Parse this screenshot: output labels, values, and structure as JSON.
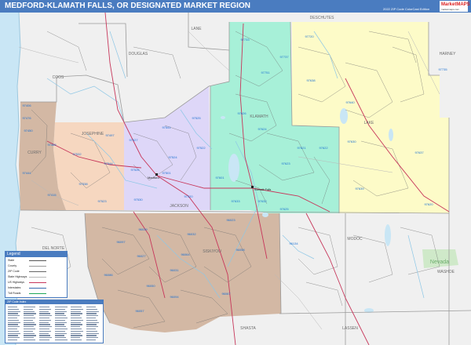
{
  "header": {
    "title": "MEDFORD-KLAMATH FALLS, OR DESIGNATED MARKET REGION",
    "edition": "2022 ZIP Code ColorCast Edition",
    "logo_text": "MarketMAPS",
    "logo_sub": "marketmaps.com"
  },
  "counties": {
    "lane": "LANE",
    "douglas": "DOUGLAS",
    "coos": "COOS",
    "deschutes": "DESCHUTES",
    "harney": "HARNEY",
    "klamath": "KLAMATH",
    "lake": "LAKE",
    "josephine": "JOSEPHINE",
    "jackson": "JACKSON",
    "curry": "CURRY",
    "del_norte": "DEL NORTE",
    "modoc": "MODOC",
    "siskiyou": "SISKIYOU",
    "lassen": "LASSEN",
    "shasta": "SHASTA",
    "washoe": "WASHOE"
  },
  "states": {
    "nevada": "Nevada"
  },
  "cities": {
    "medford": "Medford",
    "klamath_falls": "Klamath Falls"
  },
  "zips": [
    {
      "label": "97733"
    },
    {
      "label": "97737"
    },
    {
      "label": "97751"
    },
    {
      "label": "97720"
    },
    {
      "label": "97638"
    },
    {
      "label": "97640"
    },
    {
      "label": "97630"
    },
    {
      "label": "97637"
    },
    {
      "label": "97620"
    },
    {
      "label": "97735"
    },
    {
      "label": "97624"
    },
    {
      "label": "97621"
    },
    {
      "label": "97626"
    },
    {
      "label": "97622"
    },
    {
      "label": "97601"
    },
    {
      "label": "97623"
    },
    {
      "label": "97632"
    },
    {
      "label": "97633"
    },
    {
      "label": "97625"
    },
    {
      "label": "97639"
    },
    {
      "label": "97541"
    },
    {
      "label": "97527"
    },
    {
      "label": "97522"
    },
    {
      "label": "97525"
    },
    {
      "label": "97524"
    },
    {
      "label": "97520"
    },
    {
      "label": "97530"
    },
    {
      "label": "97501"
    },
    {
      "label": "97526"
    },
    {
      "label": "97532"
    },
    {
      "label": "97497"
    },
    {
      "label": "97538"
    },
    {
      "label": "97523"
    },
    {
      "label": "97544"
    },
    {
      "label": "97415"
    },
    {
      "label": "97444"
    },
    {
      "label": "97406"
    },
    {
      "label": "97476"
    },
    {
      "label": "97450"
    },
    {
      "label": "97465"
    },
    {
      "label": "96039"
    },
    {
      "label": "96032"
    },
    {
      "label": "96097"
    },
    {
      "label": "96064"
    },
    {
      "label": "96023"
    },
    {
      "label": "96058"
    },
    {
      "label": "96134"
    },
    {
      "label": "96027"
    },
    {
      "label": "96086"
    },
    {
      "label": "96050"
    },
    {
      "label": "96031"
    },
    {
      "label": "96094"
    },
    {
      "label": "96057"
    },
    {
      "label": "96067"
    }
  ],
  "legend": {
    "title": "Legend",
    "items": [
      {
        "label": "State"
      },
      {
        "label": "County"
      },
      {
        "label": "ZIP Code"
      },
      {
        "label": "State Highways"
      },
      {
        "label": "US Highways"
      },
      {
        "label": "Interstates"
      },
      {
        "label": "Toll Roads"
      }
    ]
  },
  "index": {
    "title": "ZIP Code Index"
  },
  "colors": {
    "title_bar": "#4a7cc0",
    "background_land": "#f0f0f0",
    "water": "#c9e6f5",
    "green": "#a7f0d8",
    "lavender": "#ded7f8",
    "yellow": "#fdfbc8",
    "peach": "#f6d7c0",
    "tan": "#d3b8a4",
    "zip_label": "#1a6fd1",
    "highway": "#c7365a"
  }
}
